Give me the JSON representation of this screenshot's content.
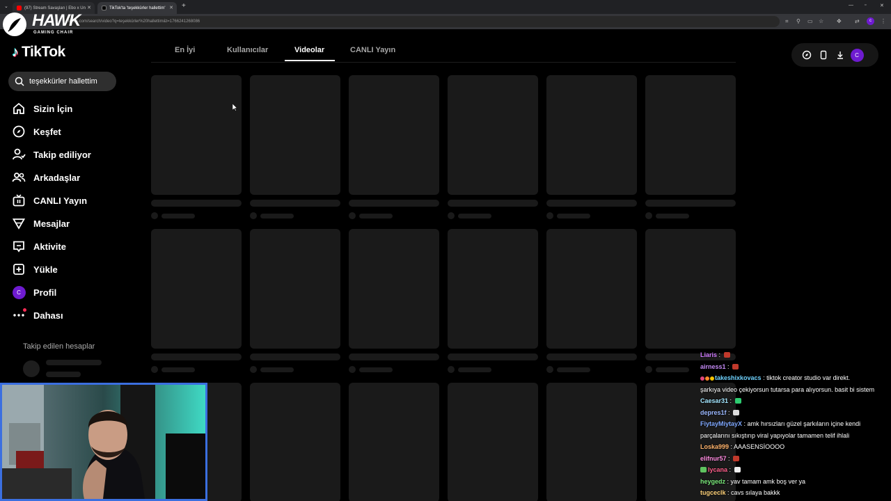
{
  "browser": {
    "tabs": [
      {
        "label": "(97) Stream Savaşları | Ebo x Un",
        "icon": "youtube-icon"
      },
      {
        "label": "TikTok'ta 'teşekkürler hallettim'",
        "icon": "tiktok-icon"
      }
    ],
    "url": "tiktok.com/search/video?q=teşekkürler%20hallettim&t=1766241268086"
  },
  "overlay": {
    "brand": "HAWK",
    "brand_sub": "GAMING CHAIR"
  },
  "app": {
    "logo": "TikTok"
  },
  "search": {
    "query": "teşekkürler hallettim"
  },
  "sidebar": {
    "items": [
      {
        "label": "Sizin İçin",
        "icon": "home-icon"
      },
      {
        "label": "Keşfet",
        "icon": "compass-icon"
      },
      {
        "label": "Takip ediliyor",
        "icon": "following-icon"
      },
      {
        "label": "Arkadaşlar",
        "icon": "friends-icon"
      },
      {
        "label": "CANLI Yayın",
        "icon": "live-icon"
      },
      {
        "label": "Mesajlar",
        "icon": "messages-icon"
      },
      {
        "label": "Aktivite",
        "icon": "activity-icon"
      },
      {
        "label": "Yükle",
        "icon": "upload-icon"
      },
      {
        "label": "Profil",
        "icon": "avatar",
        "avatar_letter": "C"
      },
      {
        "label": "Dahası",
        "icon": "more-icon"
      }
    ],
    "following_header": "Takip edilen hesaplar"
  },
  "search_tabs": [
    {
      "label": "En İyi"
    },
    {
      "label": "Kullanıcılar"
    },
    {
      "label": "Videolar",
      "active": true
    },
    {
      "label": "CANLI Yayın"
    }
  ],
  "toolbar": {
    "icons": [
      "compass-icon",
      "phone-icon",
      "download-icon"
    ],
    "avatar_letter": "C"
  },
  "colors": {
    "accent": "#fe2c55",
    "avatar": "#6e1bd0",
    "webcam_border": "#3b6fe0"
  },
  "chat": [
    {
      "user": "Liaris",
      "color": "#d07cff",
      "text": "",
      "emote": "#c0392b"
    },
    {
      "user": "airness1",
      "color": "#c48af5",
      "text": "",
      "emote": "#c0392b"
    },
    {
      "user": "takeshixkovacs",
      "color": "#6fd3ff",
      "text": ": tiktok creator studio var direkt.",
      "badges": true
    },
    {
      "user": "",
      "color": "#fff",
      "text": "şarkıya video çekiyorsun tutarsa para alıyorsun. basit bi sistem"
    },
    {
      "user": "Caesar31",
      "color": "#a3e6ff",
      "text": "",
      "emote": "#2ecc71"
    },
    {
      "user": "depres1f",
      "color": "#9bb8ff",
      "text": "",
      "emote": "#dddddd"
    },
    {
      "user": "FiytayMiytayX",
      "color": "#7fa8ff",
      "text": ": amk hırsızları güzel şarkıların içine kendi"
    },
    {
      "user": "",
      "color": "#fff",
      "text": "parçalarını sıkıştırıp viral yapıyolar tamamen telif ihlali"
    },
    {
      "user": "Loska999",
      "color": "#ffb36b",
      "text": ": AAASENSİOOOO"
    },
    {
      "user": "elifnur57",
      "color": "#ff8be0",
      "text": "",
      "emote": "#c0392b"
    },
    {
      "user": "lycana",
      "color": "#ff5e8a",
      "text": "",
      "emote": "#eeeeee",
      "badge": true
    },
    {
      "user": "heygedz",
      "color": "#79e879",
      "text": ": yav tamam amk boş ver ya"
    },
    {
      "user": "tugceclk",
      "color": "#ffd27a",
      "text": ": cavs sılaya bakkk"
    }
  ]
}
